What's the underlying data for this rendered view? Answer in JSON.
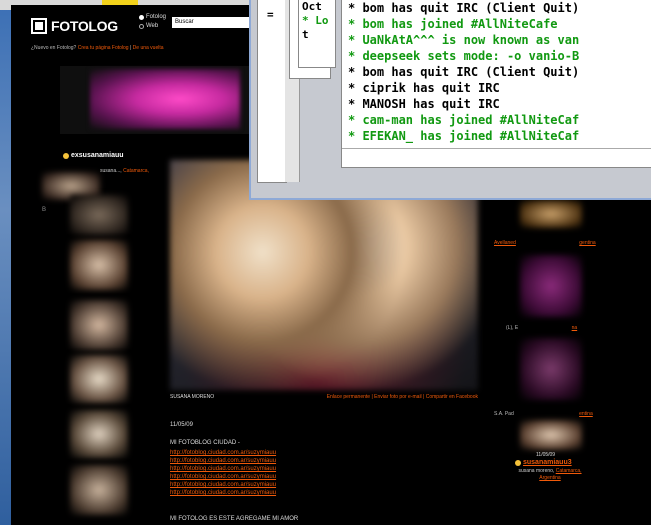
{
  "fotolog": {
    "logo_text": "FOTOLOG",
    "radio_fotolog": "Fotolog",
    "radio_web": "Web",
    "search_placeholder": "Buscar",
    "links_prefix": "¿Nuevo en Fotolog?",
    "link_create": "Crea tu página Fotolog",
    "link_separator": "|",
    "link_tour": "De una vuelta",
    "profile_user": "exsusanamiauu",
    "profile_loc_prefix": "susana..., ",
    "profile_loc_city": "Catamarca,",
    "left_letter": "B",
    "photo_caption_left": "SUSANA MORENO",
    "photo_caption_right": "Enlace permanente | Enviar foto por e-mail | Compartir en Facebook",
    "post_date": "11/05/09",
    "post_title": "MI FOTOBLOG CIUDAD -",
    "post_links": [
      "http://fotoblog.ciudad.com.ar/suzymiauu",
      "http://fotoblog.ciudad.com.ar/suzymiauu",
      "http://fotoblog.ciudad.com.ar/suzymiauu",
      "http://fotoblog.ciudad.com.ar/suzymiauu",
      "http://fotoblog.ciudad.com.ar/suzymiauu",
      "http://fotoblog.ciudad.com.ar/suzymiauu"
    ],
    "post_footer": "MI FOTOLOG ES ESTE AGREGAME MI AMOR",
    "right_texts": {
      "r1": "Avellaned",
      "r1b": "gentina",
      "r2": "(L), E",
      "r2b": "na",
      "r3": "S.A. Pad",
      "r3b": "entina"
    },
    "right_date": "11/05/09",
    "right_user": "susanamiauu3",
    "right_user_loc_prefix": "susana moreno, ",
    "right_user_loc_city": "Catamarca,",
    "right_user_loc_country": "Argentina"
  },
  "irc": {
    "side_label": "=",
    "back_lines": [
      "Oct",
      "* Lo",
      "t"
    ],
    "lines": [
      {
        "text": "* bom has quit IRC (Client Quit)",
        "color": "#000000"
      },
      {
        "text": "* bom has joined #AllNiteCafe",
        "color": "#119911"
      },
      {
        "text": "* UaNkAtA^^^ is now known as van",
        "color": "#119911"
      },
      {
        "text": "* deepseek sets mode: -o vanio-B",
        "color": "#119911"
      },
      {
        "text": "* bom has quit IRC (Client Quit)",
        "color": "#000000"
      },
      {
        "text": "* ciprik has quit IRC",
        "color": "#000000"
      },
      {
        "text": "* MANOSH has quit IRC",
        "color": "#000000"
      },
      {
        "text": "* cam-man has joined #AllNiteCaf",
        "color": "#119911"
      },
      {
        "text": "* EFEKAN_ has joined #AllNiteCaf",
        "color": "#119911"
      }
    ]
  }
}
